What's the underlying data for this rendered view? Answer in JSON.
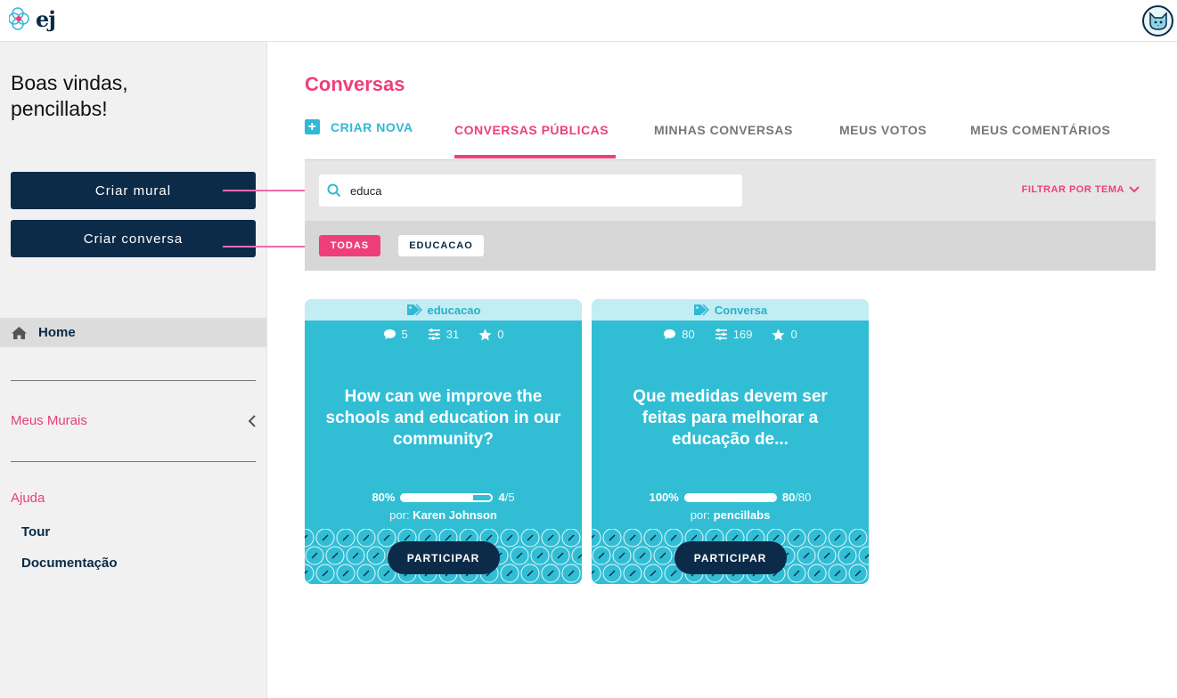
{
  "app": {
    "logo_text": "ej"
  },
  "sidebar": {
    "welcome_line1": "Boas vindas,",
    "welcome_line2": "pencillabs!",
    "create_board": "Criar mural",
    "create_conversation": "Criar conversa",
    "home": "Home",
    "my_boards": "Meus Murais",
    "help": "Ajuda",
    "tour": "Tour",
    "docs": "Documentação"
  },
  "main": {
    "title": "Conversas",
    "tabs": {
      "create": "CRIAR NOVA",
      "public": "CONVERSAS PÚBLICAS",
      "mine": "MINHAS CONVERSAS",
      "votes": "MEUS VOTOS",
      "comments": "MEUS COMENTÁRIOS"
    },
    "search": {
      "value": "educa"
    },
    "filter_theme": "FILTRAR POR TEMA",
    "chips": [
      "TODAS",
      "EDUCACAO"
    ]
  },
  "cards": [
    {
      "tag": "educacao",
      "comments": "5",
      "votes": "31",
      "favorites": "0",
      "title": "How can we improve the schools and education in our community?",
      "progress_label": "80%",
      "progress": 0.8,
      "count": "4",
      "total": "/5",
      "author_prefix": "por:",
      "author": "Karen Johnson",
      "button": "PARTICIPAR"
    },
    {
      "tag": "Conversa",
      "comments": "80",
      "votes": "169",
      "favorites": "0",
      "title": "Que medidas devem ser feitas para melhorar a educação de...",
      "progress_label": "100%",
      "progress": 1.0,
      "count": "80",
      "total": "/80",
      "author_prefix": "por:",
      "author": "pencillabs",
      "button": "PARTICIPAR"
    }
  ],
  "colors": {
    "accent": "#ee3f7a",
    "teal": "#31bed5",
    "navy": "#0c2b49"
  }
}
